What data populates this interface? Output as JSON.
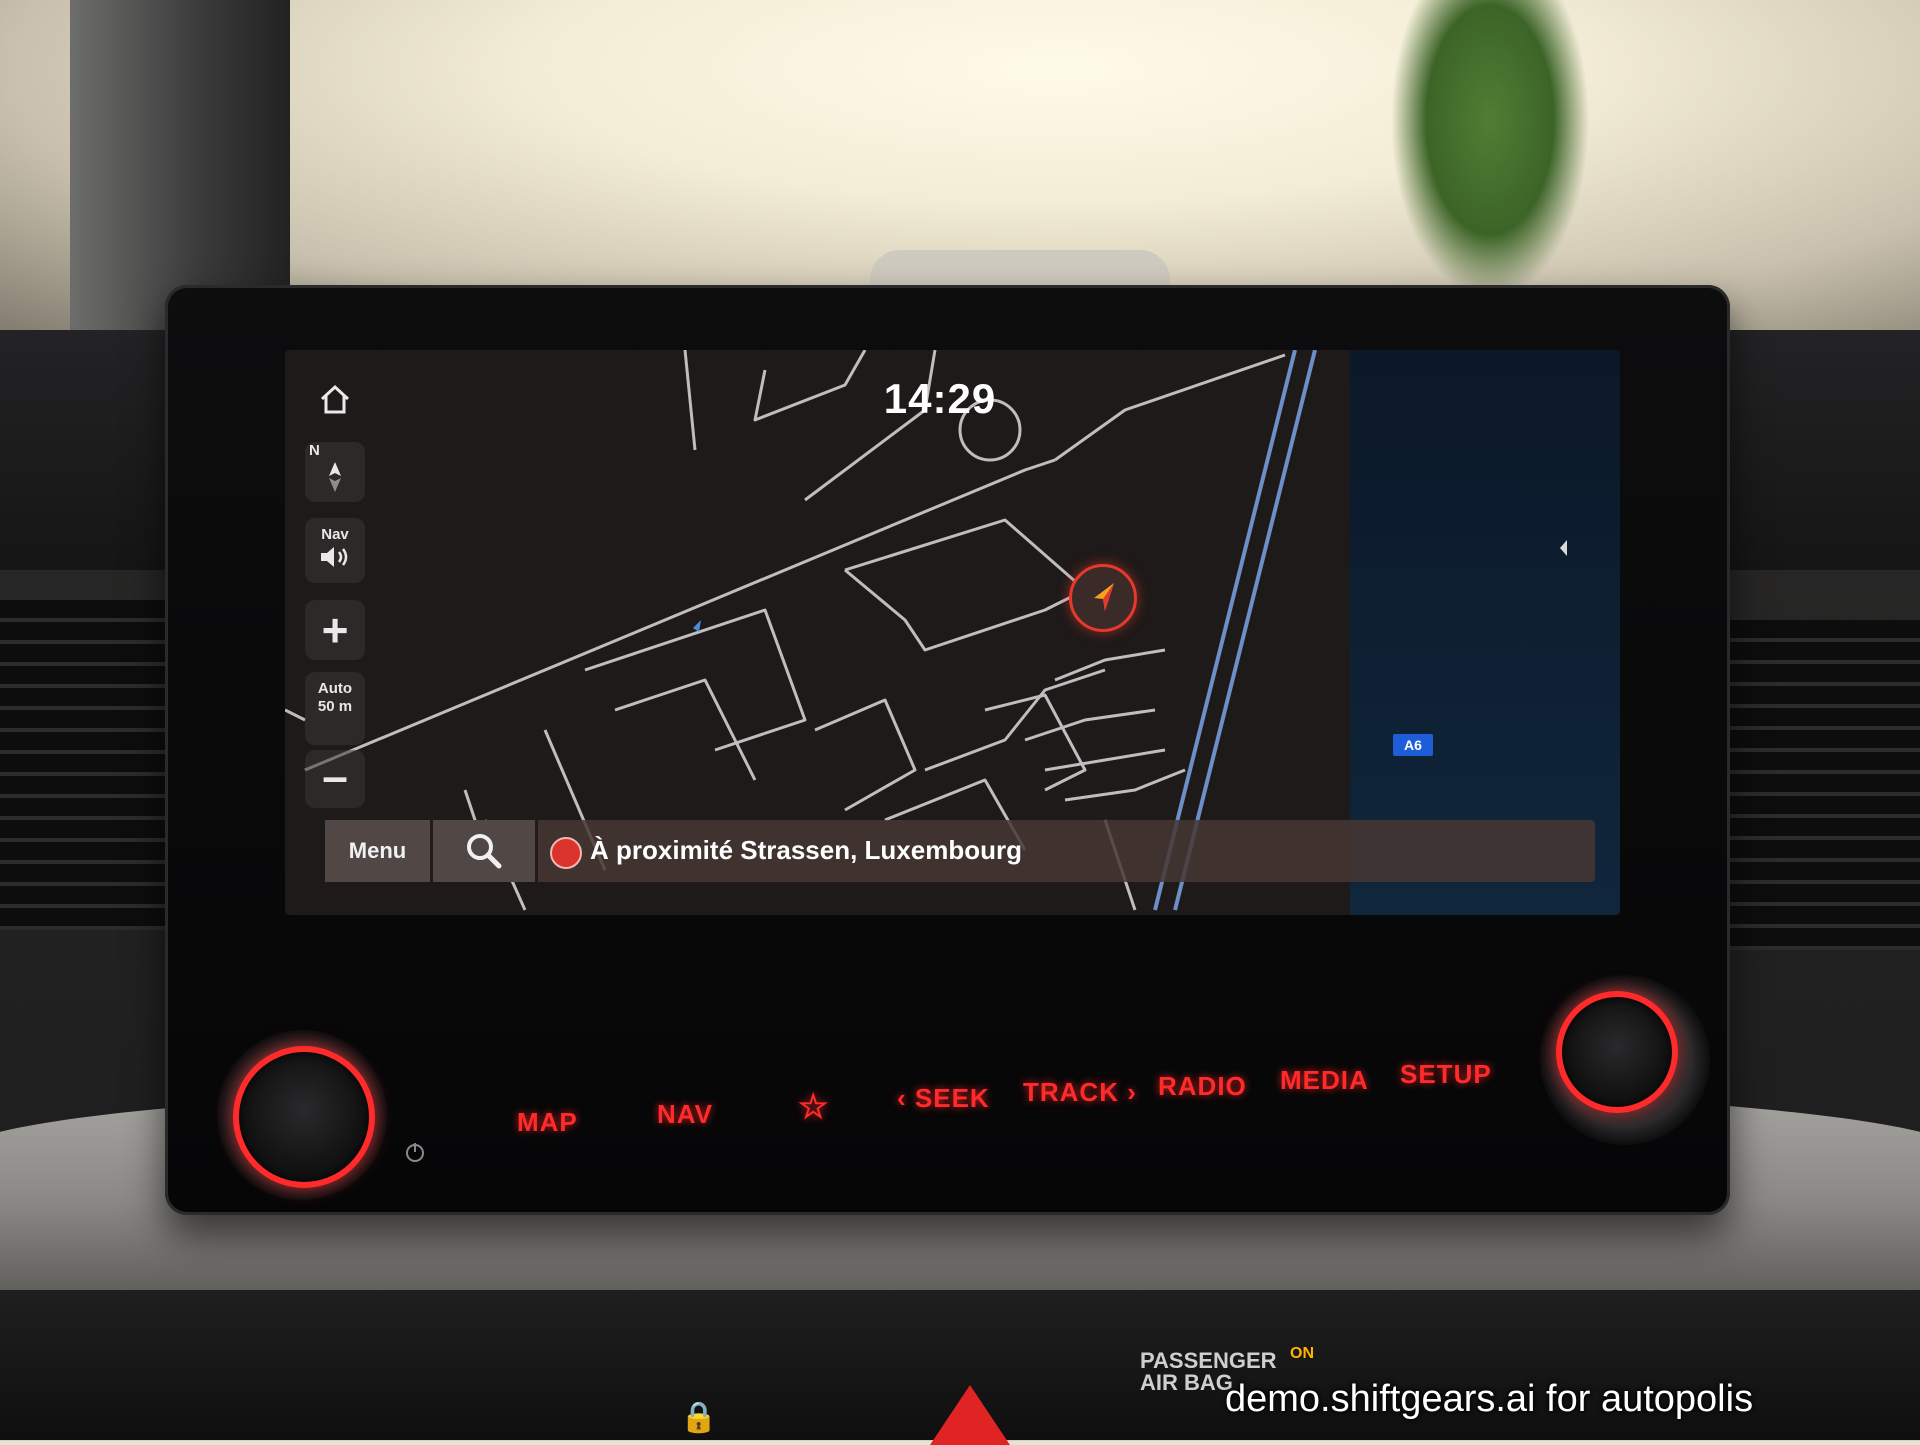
{
  "screen": {
    "clock": "14:29",
    "side_controls": {
      "home_icon": "home-icon",
      "compass_label": "N",
      "nav_volume_label": "Nav",
      "zoom_in_symbol": "+",
      "zoom_mode_label": "Auto",
      "zoom_scale_label": "50 m",
      "zoom_out_symbol": "–"
    },
    "bottom_bar": {
      "menu_label": "Menu",
      "location_text": "À proximité Strassen, Luxembourg"
    },
    "map": {
      "road_label": "A6"
    }
  },
  "hardware_buttons": {
    "map": "MAP",
    "nav": "NAV",
    "favorite_symbol": "☆",
    "seek": "‹ SEEK",
    "track": "TRACK ›",
    "radio": "RADIO",
    "media": "MEDIA",
    "setup": "SETUP"
  },
  "console": {
    "airbag_line1": "PASSENGER",
    "airbag_line2": "AIR BAG",
    "airbag_status": "ON"
  },
  "watermark": "demo.shiftgears.ai for autopolis",
  "colors": {
    "accent_red": "#ff2b2b",
    "map_background": "#1e1a19",
    "road_sign_blue": "#1d5ed8"
  }
}
